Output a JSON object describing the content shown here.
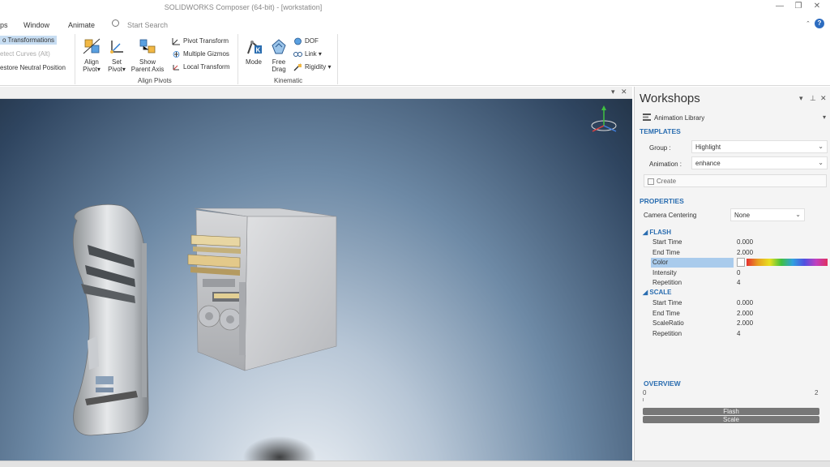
{
  "titlebar": {
    "title": "SOLIDWORKS Composer (64-bit) - [workstation]"
  },
  "menu": {
    "items": [
      "ps",
      "Window",
      "Animate"
    ],
    "search_placeholder": "Start Search"
  },
  "ribbon": {
    "list_items": [
      "o Transformations",
      "etect Curves (Alt)",
      "estore Neutral Position"
    ],
    "align_pivots": {
      "align_pivot": [
        "Align",
        "Pivot"
      ],
      "set_pivot": [
        "Set",
        "Pivot"
      ],
      "show_parent_axis": [
        "Show",
        "Parent Axis"
      ],
      "pivot_transform": "Pivot Transform",
      "multiple_gizmos": "Multiple Gizmos",
      "local_transform": "Local Transform",
      "group_label": "Align Pivots"
    },
    "kinematic": {
      "mode": "Mode",
      "free_drag": [
        "Free",
        "Drag"
      ],
      "dof": "DOF",
      "link": "Link",
      "rigidity": "Rigidity",
      "group_label": "Kinematic"
    }
  },
  "panel": {
    "title": "Workshops",
    "library": "Animation Library",
    "templates_heading": "TEMPLATES",
    "group_label": "Group :",
    "group_value": "Highlight",
    "animation_label": "Animation :",
    "animation_value": "enhance",
    "create_label": "Create",
    "properties_heading": "PROPERTIES",
    "camera_centering_label": "Camera Centering",
    "camera_centering_value": "None",
    "flash": {
      "heading": "FLASH",
      "rows": [
        {
          "key": "Start Time",
          "value": "0.000"
        },
        {
          "key": "End Time",
          "value": "2.000"
        },
        {
          "key": "Color",
          "value": ""
        },
        {
          "key": "Intensity",
          "value": "0"
        },
        {
          "key": "Repetition",
          "value": "4"
        }
      ]
    },
    "scale": {
      "heading": "SCALE",
      "rows": [
        {
          "key": "Start Time",
          "value": "0.000"
        },
        {
          "key": "End Time",
          "value": "2.000"
        },
        {
          "key": "ScaleRatio",
          "value": "2.000"
        },
        {
          "key": "Repetition",
          "value": "4"
        }
      ]
    },
    "overview": {
      "heading": "OVERVIEW",
      "tick_start": "0",
      "tick_end": "2",
      "bars": [
        "Flash",
        "Scale"
      ]
    }
  },
  "icons": {
    "search": "search-icon",
    "gizmo": "axis-gizmo-icon"
  }
}
